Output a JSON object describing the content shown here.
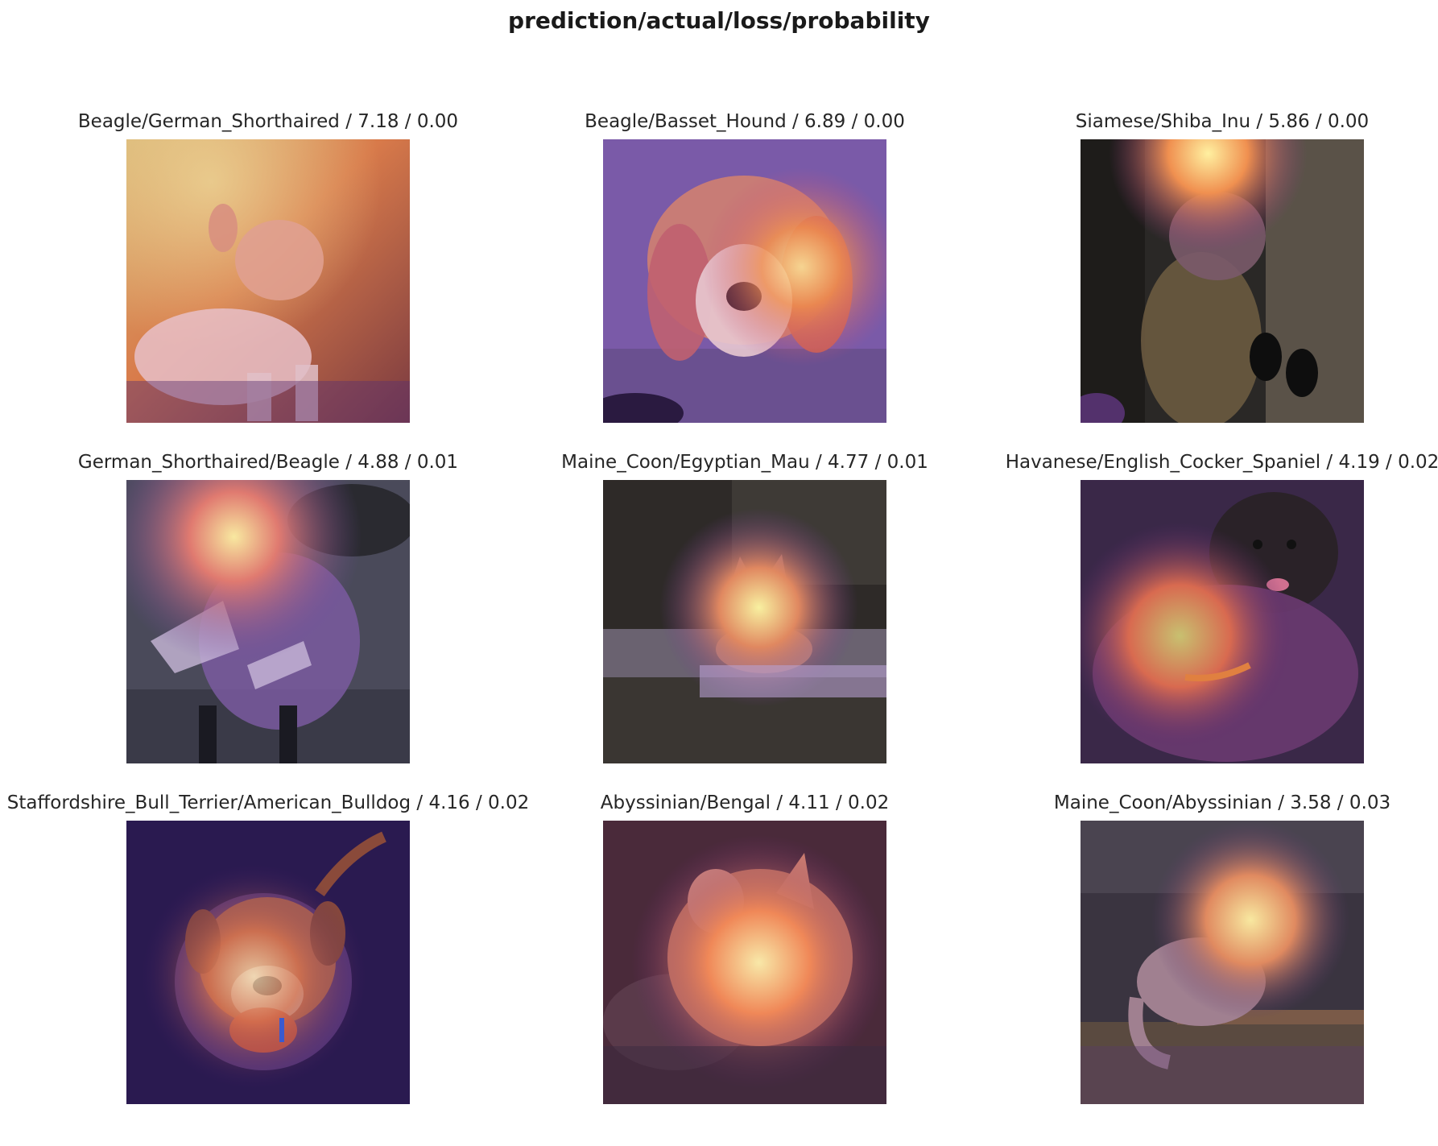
{
  "figure": {
    "title": "prediction/actual/loss/probability"
  },
  "panels": [
    {
      "caption": "Beagle/German_Shorthaired / 7.18 / 0.00",
      "prediction": "Beagle",
      "actual": "German_Shorthaired",
      "loss": 7.18,
      "probability": 0.0
    },
    {
      "caption": "Beagle/Basset_Hound / 6.89 / 0.00",
      "prediction": "Beagle",
      "actual": "Basset_Hound",
      "loss": 6.89,
      "probability": 0.0
    },
    {
      "caption": "Siamese/Shiba_Inu / 5.86 / 0.00",
      "prediction": "Siamese",
      "actual": "Shiba_Inu",
      "loss": 5.86,
      "probability": 0.0
    },
    {
      "caption": "German_Shorthaired/Beagle / 4.88 / 0.01",
      "prediction": "German_Shorthaired",
      "actual": "Beagle",
      "loss": 4.88,
      "probability": 0.01
    },
    {
      "caption": "Maine_Coon/Egyptian_Mau / 4.77 / 0.01",
      "prediction": "Maine_Coon",
      "actual": "Egyptian_Mau",
      "loss": 4.77,
      "probability": 0.01
    },
    {
      "caption": "Havanese/English_Cocker_Spaniel / 4.19 / 0.02",
      "prediction": "Havanese",
      "actual": "English_Cocker_Spaniel",
      "loss": 4.19,
      "probability": 0.02
    },
    {
      "caption": "Staffordshire_Bull_Terrier/American_Bulldog / 4.16 / 0.02",
      "prediction": "Staffordshire_Bull_Terrier",
      "actual": "American_Bulldog",
      "loss": 4.16,
      "probability": 0.02
    },
    {
      "caption": "Abyssinian/Bengal / 4.11 / 0.02",
      "prediction": "Abyssinian",
      "actual": "Bengal",
      "loss": 4.11,
      "probability": 0.02
    },
    {
      "caption": "Maine_Coon/Abyssinian / 3.58 / 0.03",
      "prediction": "Maine_Coon",
      "actual": "Abyssinian",
      "loss": 3.58,
      "probability": 0.03
    }
  ],
  "heatmap_colors": {
    "hot": "#fff2a8",
    "warm": "#f5a060",
    "mid": "#c24a7a",
    "cool": "#3d1f6e"
  }
}
